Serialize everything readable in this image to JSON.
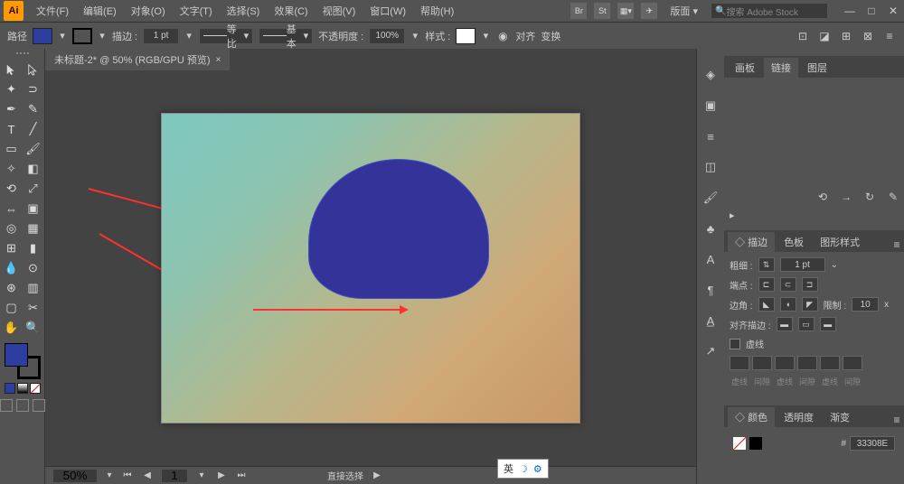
{
  "app": {
    "logo": "Ai"
  },
  "menu": {
    "file": "文件(F)",
    "edit": "编辑(E)",
    "object": "对象(O)",
    "type": "文字(T)",
    "select": "选择(S)",
    "effect": "效果(C)",
    "view": "视图(V)",
    "window": "窗口(W)",
    "help": "帮助(H)"
  },
  "top_icons": {
    "br": "Br",
    "st": "St"
  },
  "workspace": "版面",
  "search": {
    "placeholder": "搜索 Adobe Stock"
  },
  "window_buttons": {
    "min": "—",
    "max": "□",
    "close": "✕"
  },
  "options": {
    "path_label": "路径",
    "stroke_label": "描边 :",
    "stroke_weight": "1 pt",
    "uniform": "等比",
    "basic": "基本",
    "opacity_label": "不透明度 :",
    "opacity": "100%",
    "style_label": "样式 :",
    "align_label": "对齐",
    "transform_label": "变换"
  },
  "doc": {
    "tab_title": "未标题-2* @ 50% (RGB/GPU 预览)",
    "close": "×"
  },
  "status": {
    "zoom": "50%",
    "page": "1",
    "tool": "直接选择"
  },
  "ime": {
    "label": "英",
    "moon": "☽",
    "gear": "⚙"
  },
  "panels": {
    "artboards": "画板",
    "links": "链接",
    "layers": "图层",
    "stroke": "描边",
    "swatches": "色板",
    "graphic_styles": "图形样式",
    "color": "颜色",
    "transparency": "透明度",
    "gradient": "渐变"
  },
  "stroke_panel": {
    "weight_label": "粗细 :",
    "weight": "1 pt",
    "cap_label": "端点 :",
    "corner_label": "边角 :",
    "limit_label": "限制 :",
    "limit": "10",
    "limit_unit": "x",
    "align_label": "对齐描边 :",
    "dashed_label": "虚线",
    "dash": "虚线",
    "gap": "间隙"
  },
  "color_panel": {
    "hex_prefix": "#",
    "hex": "33308E"
  }
}
